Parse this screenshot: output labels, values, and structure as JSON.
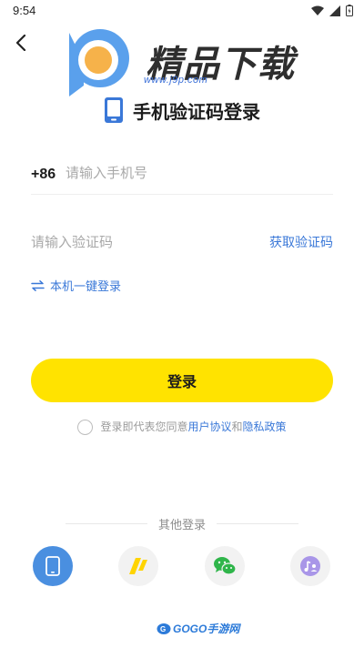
{
  "status_bar": {
    "time": "9:54"
  },
  "logo": {
    "text": "精品下载",
    "url": "www.j9p.com"
  },
  "heading": {
    "title": "手机验证码登录"
  },
  "phone": {
    "country_code": "+86",
    "placeholder": "请输入手机号"
  },
  "code": {
    "placeholder": "请输入验证码",
    "get_code_label": "获取验证码"
  },
  "one_tap": {
    "label": "本机一键登录"
  },
  "login_button": {
    "label": "登录"
  },
  "agreement": {
    "prefix": "登录即代表您同意",
    "user_agreement": "用户协议",
    "and": "和",
    "privacy_policy": "隐私政策"
  },
  "other_login": {
    "label": "其他登录"
  },
  "social": [
    {
      "icon": "phone-icon"
    },
    {
      "icon": "yellow-slash-logo-icon"
    },
    {
      "icon": "wechat-icon"
    },
    {
      "icon": "music-user-icon"
    }
  ],
  "watermark": {
    "text": "GOGO手游网"
  },
  "colors": {
    "accent_yellow": "#ffe300",
    "link_blue": "#3a78d8",
    "phone_btn_blue": "#4a8fe0"
  }
}
